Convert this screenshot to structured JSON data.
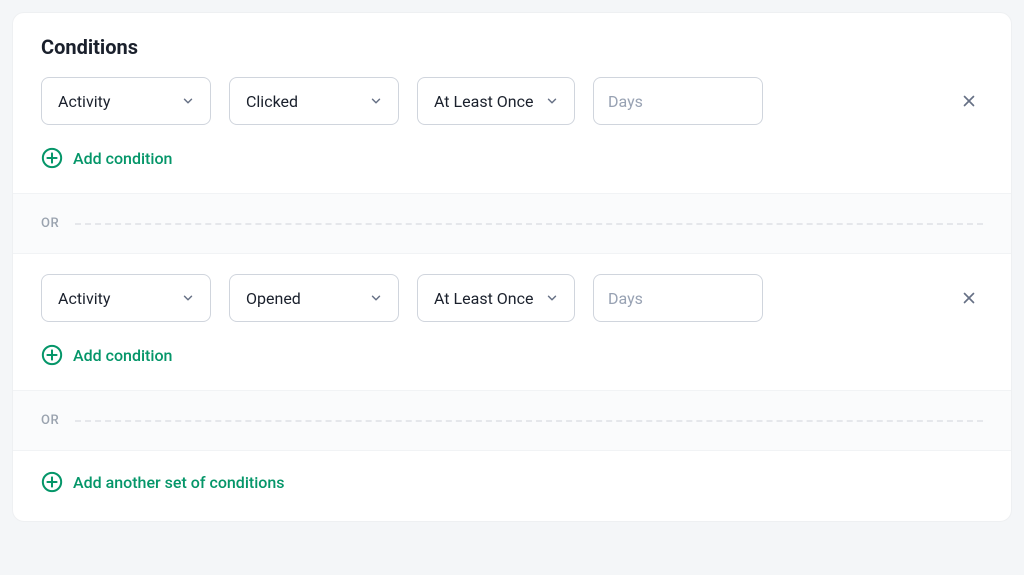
{
  "colors": {
    "accent": "#059669"
  },
  "header": {
    "title": "Conditions"
  },
  "groups": [
    {
      "rows": [
        {
          "type_label": "Activity",
          "event_label": "Clicked",
          "freq_label": "At Least Once",
          "days_value": "",
          "days_placeholder": "Days"
        }
      ],
      "add_label": "Add condition"
    },
    {
      "rows": [
        {
          "type_label": "Activity",
          "event_label": "Opened",
          "freq_label": "At Least Once",
          "days_value": "",
          "days_placeholder": "Days"
        }
      ],
      "add_label": "Add condition"
    }
  ],
  "divider_label": "OR",
  "footer": {
    "add_set_label": "Add another set of conditions"
  }
}
